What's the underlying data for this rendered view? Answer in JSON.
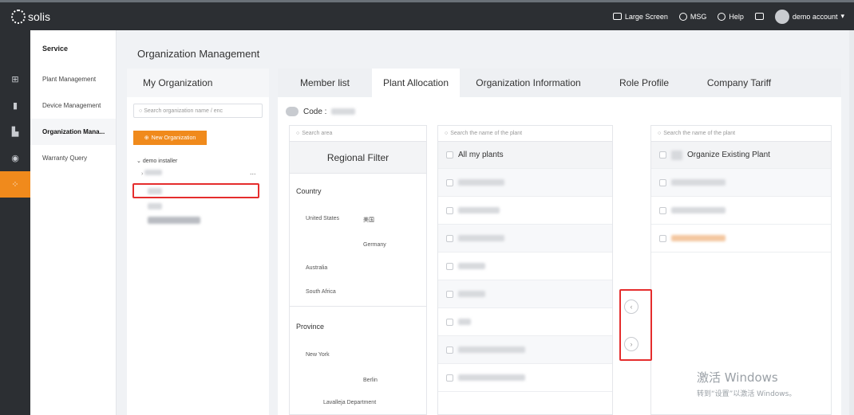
{
  "brand": {
    "logo_text": "solis"
  },
  "topbar": {
    "large_screen": "Large Screen",
    "msg": "MSG",
    "help": "Help",
    "account": "demo account"
  },
  "rail": {
    "icons": [
      "grid-icon",
      "device-icon",
      "chart-icon",
      "eye-icon",
      "apps-icon"
    ]
  },
  "menu": {
    "heading": "Service",
    "items": [
      {
        "label": "Plant Management"
      },
      {
        "label": "Device Management"
      },
      {
        "label": "Organization Mana..."
      },
      {
        "label": "Warranty Query"
      }
    ]
  },
  "page": {
    "title": "Organization Management"
  },
  "org_panel": {
    "title": "My Organization",
    "search_placeholder": "Search organization name / enc",
    "new_button": "New Organization",
    "tree_root": "demo installer",
    "more": "..."
  },
  "tabs": [
    {
      "label": "Member list"
    },
    {
      "label": "Plant Allocation"
    },
    {
      "label": "Organization Information"
    },
    {
      "label": "Role Profile"
    },
    {
      "label": "Company Tariff"
    }
  ],
  "code_label": "Code :",
  "region": {
    "search_placeholder": "Search area",
    "heading": "Regional Filter",
    "country_label": "Country",
    "countries": [
      "United States",
      "美国",
      "Germany",
      "Australia",
      "South Africa"
    ],
    "province_label": "Province",
    "provinces": [
      "New York",
      "Berlin",
      "Lavalleja Department"
    ]
  },
  "plants_left": {
    "search_placeholder": "Search the name of the plant",
    "heading": "All my plants"
  },
  "plants_right": {
    "search_placeholder": "Search the name of the plant",
    "heading": "Organize Existing Plant"
  },
  "arrows": {
    "left": "‹",
    "right": "›"
  },
  "watermark": {
    "line1": "激活 Windows",
    "line2": "转到“设置”以激活 Windows。"
  },
  "colors": {
    "accent": "#f08a1c",
    "highlight": "#e52d2d",
    "topbar": "#2c2f33"
  }
}
